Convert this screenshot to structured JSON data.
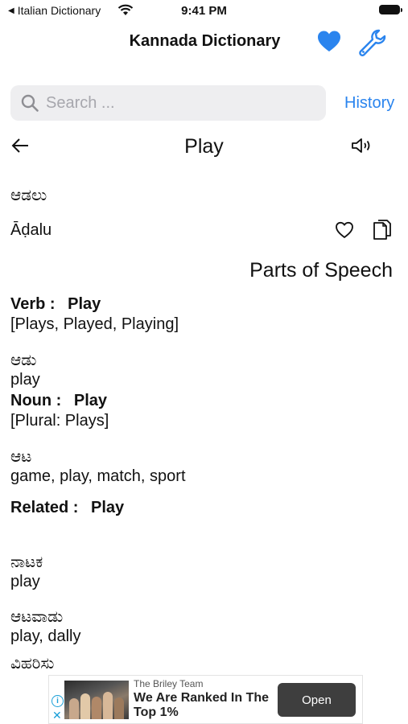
{
  "status_bar": {
    "back_app": "Italian Dictionary",
    "time": "9:41 PM"
  },
  "header": {
    "title": "Kannada Dictionary",
    "icons": [
      "heart-icon",
      "wrench-icon"
    ],
    "accent_color": "#2a84ee"
  },
  "search": {
    "placeholder": "Search ...",
    "value": "",
    "history_label": "History"
  },
  "word": {
    "title": "Play",
    "kannada": "ಆಡಲು",
    "transliteration": "Āḍalu"
  },
  "parts_of_speech": {
    "heading": "Parts of Speech",
    "entries": [
      {
        "label": "Verb :",
        "word": "Play",
        "forms": "[Plays, Played, Playing]",
        "kannada": "ಆಡು",
        "translation": "play"
      },
      {
        "label": "Noun :",
        "word": "Play",
        "forms": "[Plural: Plays]",
        "kannada": "ಆಟ",
        "translation": "game, play, match, sport"
      },
      {
        "label": "Related :",
        "word": "Play",
        "items": [
          {
            "kannada": "ನಾಟಕ",
            "translation": "play"
          },
          {
            "kannada": "ಆಟವಾಡು",
            "translation": "play, dally"
          }
        ],
        "partial_next": "ವಿಹರಿಸು"
      }
    ]
  },
  "ad": {
    "sponsor": "The Briley Team",
    "headline": "We Are Ranked In The Top 1%",
    "button": "Open"
  }
}
